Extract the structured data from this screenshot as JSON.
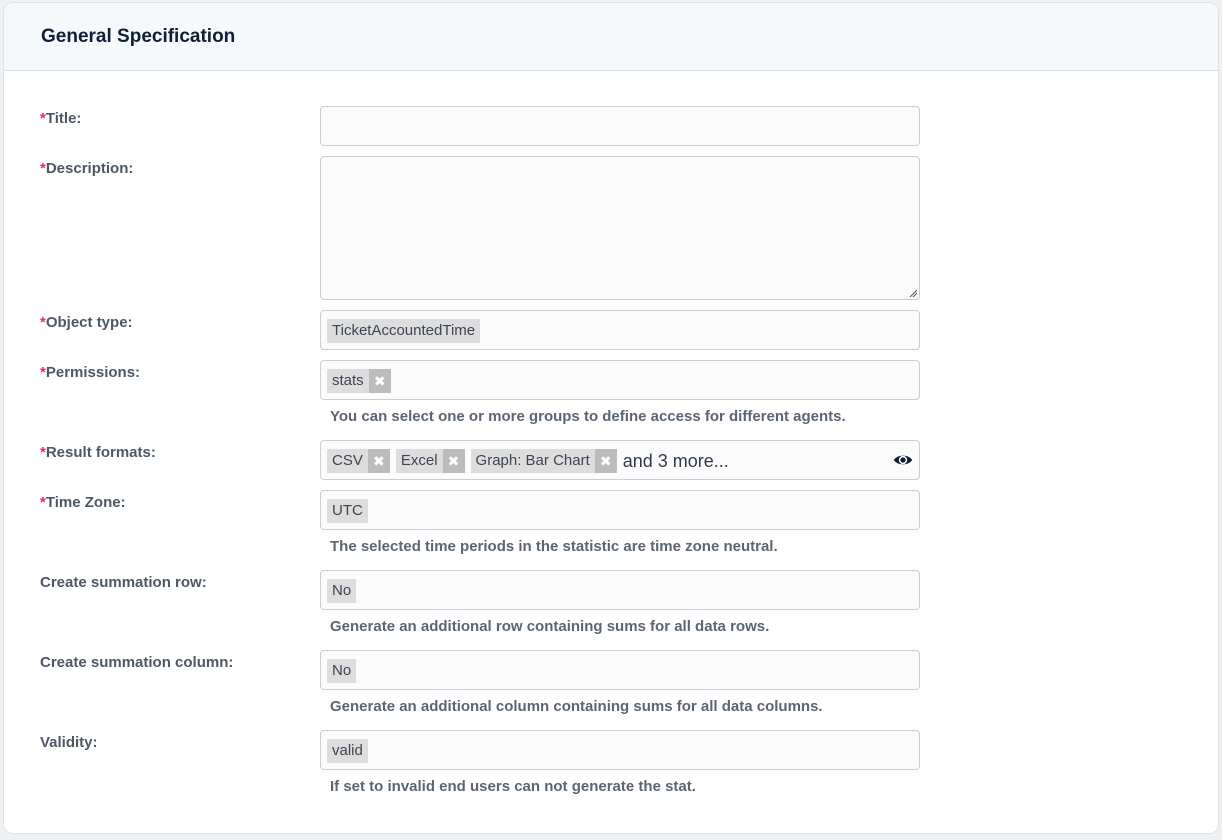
{
  "header": {
    "title": "General Specification"
  },
  "required_mark": "*",
  "fields": {
    "title": {
      "label": "Title:",
      "value": ""
    },
    "description": {
      "label": "Description:",
      "value": ""
    },
    "object_type": {
      "label": "Object type:",
      "value": "TicketAccountedTime"
    },
    "permissions": {
      "label": "Permissions:",
      "tags": [
        "stats"
      ],
      "hint": "You can select one or more groups to define access for different agents."
    },
    "result_formats": {
      "label": "Result formats:",
      "tags": [
        "CSV",
        "Excel",
        "Graph: Bar Chart"
      ],
      "more": "and 3 more..."
    },
    "time_zone": {
      "label": "Time Zone:",
      "value": "UTC",
      "hint": "The selected time periods in the statistic are time zone neutral."
    },
    "summation_row": {
      "label": "Create summation row:",
      "value": "No",
      "hint": "Generate an additional row containing sums for all data rows."
    },
    "summation_column": {
      "label": "Create summation column:",
      "value": "No",
      "hint": "Generate an additional column containing sums for all data columns."
    },
    "validity": {
      "label": "Validity:",
      "value": "valid",
      "hint": "If set to invalid end users can not generate the stat."
    }
  },
  "colors": {
    "required": "#e0305a",
    "tag_bg": "#dddddd",
    "tag_remove_bg": "#bcbcbc",
    "header_bg": "#f6f9fc"
  },
  "icons": {
    "remove": "remove-x-icon",
    "eye": "eye-icon"
  }
}
